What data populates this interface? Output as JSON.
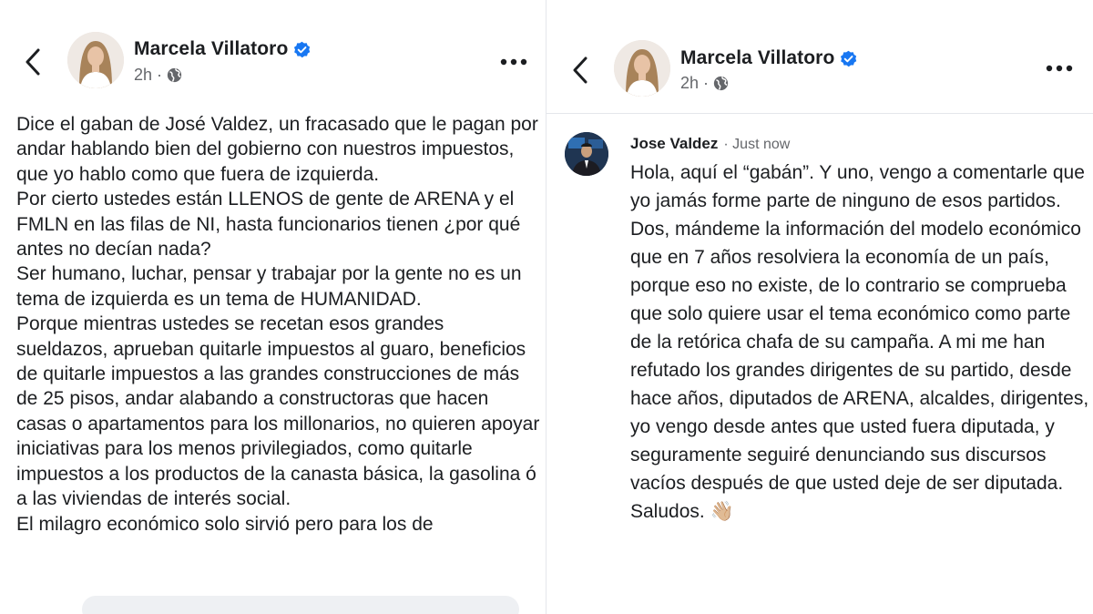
{
  "left_post": {
    "author": "Marcela Villatoro",
    "time": "2h",
    "separator": "·",
    "paragraphs": [
      "Dice el gaban de José Valdez, un fracasado que le pagan por andar hablando bien del gobierno con nuestros impuestos, que yo hablo como que fuera de izquierda.",
      "Por cierto ustedes están LLENOS de gente de ARENA y el FMLN en las filas de NI, hasta funcionarios tienen ¿por qué antes no decían nada?",
      "Ser humano, luchar, pensar y trabajar por la gente no es un tema de izquierda es un tema de HUMANIDAD.",
      "Porque mientras ustedes se recetan esos grandes sueldazos, aprueban quitarle impuestos al guaro, beneficios de quitarle impuestos a las grandes construcciones de más de 25 pisos, andar alabando a constructoras que hacen casas o apartamentos para los millonarios, no quieren apoyar iniciativas para los menos privilegiados, como quitarle impuestos a los productos de la canasta básica, la gasolina ó a las viviendas de interés social.",
      "El milagro económico solo sirvió pero para los de"
    ]
  },
  "right_post": {
    "author": "Marcela Villatoro",
    "time": "2h",
    "separator": "·"
  },
  "comment": {
    "author": "Jose Valdez",
    "time": "· Just now",
    "text": "Hola, aquí el “gabán”. Y uno, vengo a comentarle que yo jamás forme parte de ninguno de esos partidos. Dos, mándeme la información del modelo económico que en 7 años resolviera la economía de un país, porque eso no existe, de lo contrario se comprueba que solo quiere usar el tema económico como parte de la retórica chafa de su campaña. A mi me han refutado los grandes dirigentes de su partido, desde hace años, diputados de ARENA, alcaldes, dirigentes, yo vengo desde antes que usted fuera diputada, y seguramente seguiré denunciando sus discursos vacíos después de que usted deje de ser diputada. Saludos.",
    "emoji": "👋🏼"
  },
  "icons": {
    "back": "chevron-left-icon",
    "verified": "verified-badge-icon",
    "audience": "globe-icon",
    "more": "more-dots-icon"
  },
  "colors": {
    "verified_blue": "#1877f2",
    "meta_gray": "#65676b",
    "text": "#1c1e21"
  }
}
